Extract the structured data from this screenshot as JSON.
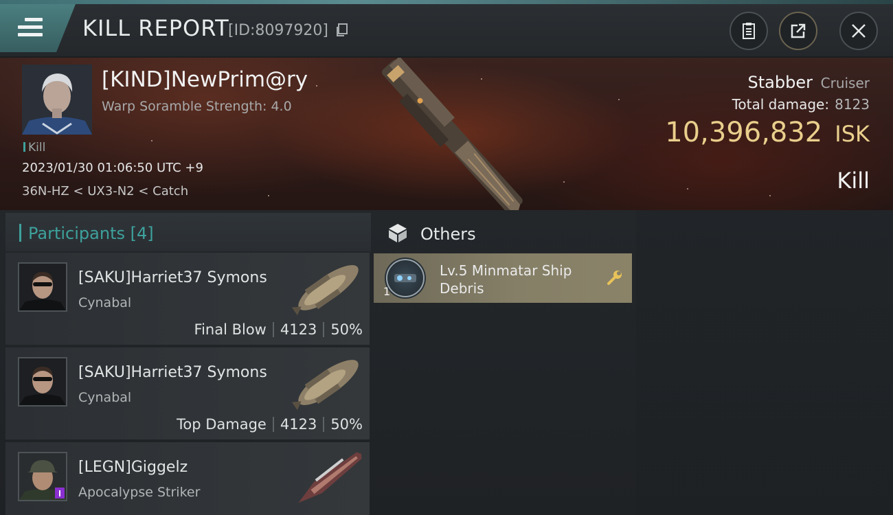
{
  "header": {
    "menu_icon": "hamburger-icon",
    "title": "KILL REPORT",
    "report_id": "[ID:8097920]",
    "copy_icon": "copy-icon",
    "buttons": [
      {
        "name": "report-button",
        "icon": "clipboard-icon"
      },
      {
        "name": "share-button",
        "icon": "external-link-icon"
      },
      {
        "name": "close-button",
        "icon": "close-icon"
      }
    ]
  },
  "victim": {
    "pilot_name": "[KIND]NewPrim@ry",
    "scramble": "Warp Soramble Strength: 4.0",
    "kill_tag": "Kill",
    "datetime": "2023/01/30 01:06:50 UTC +9",
    "location": "36N-HZ < UX3-N2 < Catch",
    "ship_name": "Stabber",
    "ship_class": "Cruiser",
    "total_damage_label": "Total damage:",
    "total_damage": "8123",
    "isk_value": "10,396,832",
    "isk_unit": "ISK",
    "result": "Kill"
  },
  "participants": {
    "label": "Participants",
    "count": "[4]",
    "rows": [
      {
        "name": "[SAKU]Harriet37 Symons",
        "ship": "Cynabal",
        "tag": "Final Blow",
        "damage": "4123",
        "percent": "50%"
      },
      {
        "name": "[SAKU]Harriet37 Symons",
        "ship": "Cynabal",
        "tag": "Top Damage",
        "damage": "4123",
        "percent": "50%"
      },
      {
        "name": "[LEGN]Giggelz",
        "ship": "Apocalypse Striker",
        "tag": "",
        "damage": "",
        "percent": ""
      }
    ]
  },
  "others": {
    "label": "Others",
    "icon": "box-icon",
    "items": [
      {
        "qty": "1",
        "name": "Lv.5 Minmatar Ship Debris",
        "icon": "wrench-icon"
      }
    ]
  },
  "colors": {
    "accent_teal": "#3ea19d",
    "isk_gold": "#e9cf8c",
    "debris_bg": "#857f67"
  }
}
